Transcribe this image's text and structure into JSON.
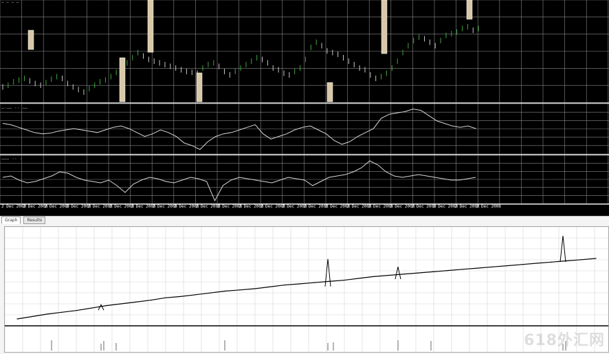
{
  "terminal": {
    "header_text": "—  —  —  —",
    "panes": [
      {
        "name": "price",
        "label": ""
      },
      {
        "name": "indicator-1",
        "label": "—·—— ·· ——"
      },
      {
        "name": "indicator-2",
        "label": "——— ·· ·"
      }
    ],
    "time_labels": [
      "2 Dec 2008",
      "2 Dec 2008",
      "2 Dec 2008",
      "2 Dec 2008",
      "2 Dec 2008",
      "2 Dec 2008",
      "2 Dec 2008",
      "2 Dec 2008",
      "2 Dec 2008",
      "2 Dec 2008",
      "2 Dec 2008",
      "2 Dec 2008",
      "2 Dec 2008",
      "2 Dec 2008",
      "2 Dec 2008",
      "2 Dec 2008",
      "2 Dec 2008",
      "2 Dec 2008",
      "2 Dec 2008",
      "2 Dec 2008",
      "2 Dec 2008",
      "2 Dec 2008",
      "2 Dec 2008"
    ],
    "colors": {
      "background": "#000000",
      "grid": "#8a8a8a",
      "bull": "#3fa83f",
      "bear": "#c8c8c8",
      "line": "#d8d8d8",
      "flag": "#d9c8a8"
    }
  },
  "tester": {
    "tabs": [
      {
        "label": "Graph",
        "active": true
      },
      {
        "label": "Results",
        "active": false
      }
    ],
    "sublabel": "",
    "colors": {
      "background": "#ffffff",
      "grid": "#d3d3d3",
      "line": "#000000"
    }
  },
  "watermark": "618外汇网",
  "chart_data": {
    "type": "line",
    "title": "",
    "xlabel": "",
    "ylabel": "",
    "series": [
      {
        "values": [
          0,
          4,
          8,
          11,
          14,
          18,
          22,
          25,
          28,
          31,
          35,
          37,
          40,
          43,
          46,
          48,
          50,
          53,
          56,
          58,
          60,
          62,
          64,
          67,
          70,
          72,
          74,
          76,
          78,
          80,
          82,
          84,
          86,
          88,
          90,
          92,
          94,
          96,
          98,
          100
        ]
      }
    ]
  }
}
